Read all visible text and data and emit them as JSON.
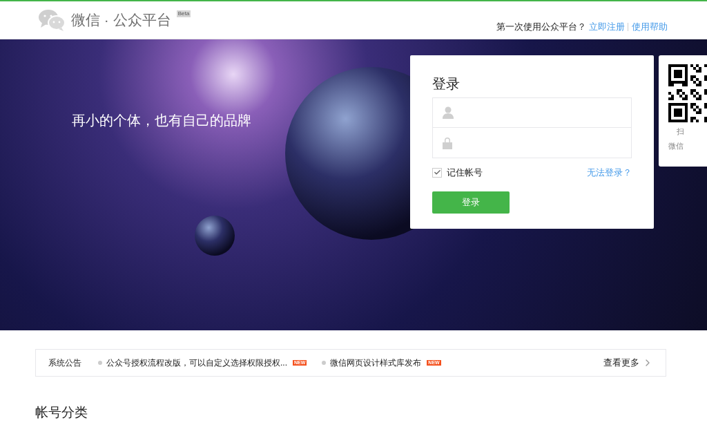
{
  "header": {
    "logo_text": "微信 · 公众平台",
    "logo_badge": "Beta",
    "prompt": "第一次使用公众平台？",
    "links": [
      "立即注册",
      "使用帮助"
    ]
  },
  "banner": {
    "slogan": "再小的个体，也有自己的品牌"
  },
  "login": {
    "title": "登录",
    "remember": {
      "label": "记住帐号",
      "checked": true
    },
    "help_link": "无法登录？",
    "submit": "登录"
  },
  "qr_card": {
    "lines": [
      "扫",
      "微信"
    ]
  },
  "notices": {
    "label": "系统公告",
    "items": [
      {
        "text": "公众号授权流程改版，可以自定义选择权限授权...",
        "badge": "NEW"
      },
      {
        "text": "微信网页设计样式库发布",
        "badge": "NEW"
      }
    ],
    "more": "查看更多"
  },
  "section": {
    "title": "帐号分类"
  }
}
